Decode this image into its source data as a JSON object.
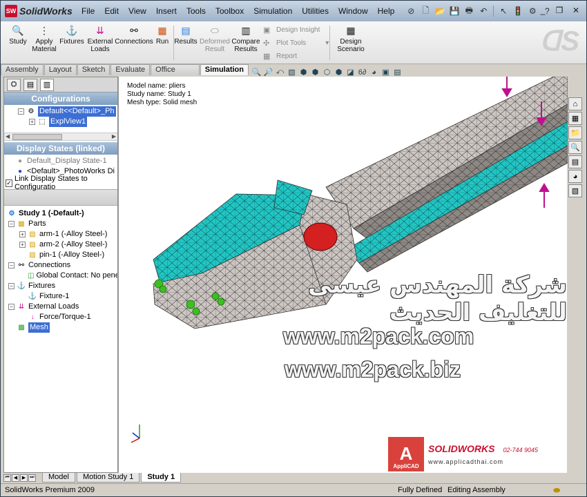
{
  "app": {
    "title": "SolidWorks"
  },
  "menu": [
    "File",
    "Edit",
    "View",
    "Insert",
    "Tools",
    "Toolbox",
    "Simulation",
    "Utilities",
    "Window",
    "Help"
  ],
  "ribbon": {
    "study": "Study",
    "apply_material": "Apply Material",
    "fixtures": "Fixtures",
    "external_loads": "External Loads",
    "connections": "Connections",
    "run": "Run",
    "results": "Results",
    "deformed_result": "Deformed Result",
    "compare_results": "Compare Results",
    "design_insight": "Design Insight",
    "plot_tools": "Plot Tools",
    "report": "Report",
    "design_scenario": "Design Scenario"
  },
  "tabs": [
    "Assembly",
    "Layout",
    "Sketch",
    "Evaluate",
    "Office Products",
    "Simulation"
  ],
  "panel": {
    "configurations_title": "Configurations",
    "config_default": "Default<<Default>_Ph",
    "config_expl": "ExplView1",
    "display_states_title": "Display States (linked)",
    "display_state_1": "Default_Display State-1",
    "display_state_2": "<Default>_PhotoWorks Di",
    "link_checkbox": "Link Display States to Configuratio"
  },
  "study_tree": {
    "root": "Study 1 (-Default-)",
    "parts": "Parts",
    "arm1": "arm-1 (-Alloy Steel-)",
    "arm2": "arm-2 (-Alloy Steel-)",
    "pin1": "pin-1 (-Alloy Steel-)",
    "connections": "Connections",
    "global_contact": "Global Contact: No penet",
    "fixtures": "Fixtures",
    "fixture1": "Fixture-1",
    "external_loads": "External Loads",
    "force_torque": "Force/Torque-1",
    "mesh": "Mesh"
  },
  "graphics": {
    "model_name": "Model name: pliers",
    "study_name": "Study name: Study 1",
    "mesh_type": "Mesh type: Solid mesh"
  },
  "watermarks": {
    "arabic": "شركة المهندس عيسى للتغليف الحديث",
    "url1": "www.m2pack.com",
    "url2": "www.m2pack.biz"
  },
  "logo": {
    "applicad": "AppliCAD",
    "brand": "SOLIDWORKS",
    "phone": "02-744 9045",
    "url": "www.applicadthai.com"
  },
  "bottom_tabs": [
    "Model",
    "Motion Study 1",
    "Study 1"
  ],
  "status": {
    "left": "SolidWorks Premium 2009",
    "fully_defined": "Fully Defined",
    "editing": "Editing Assembly"
  },
  "colors": {
    "mesh_cyan": "#1fc4c4",
    "mesh_gray": "#c8c2c0",
    "pin_red": "#d42020",
    "load_magenta": "#c0108e",
    "fixture_green": "#3cc020"
  }
}
